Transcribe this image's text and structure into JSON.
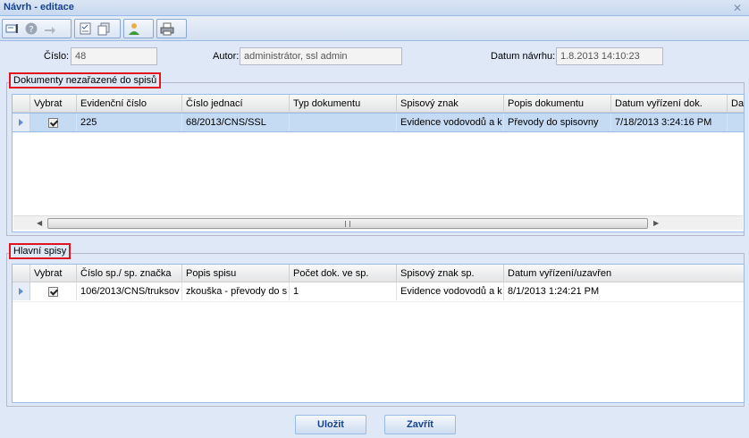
{
  "window": {
    "title": "Návrh - editace"
  },
  "form": {
    "cislo_label": "Číslo:",
    "cislo_value": "48",
    "autor_label": "Autor:",
    "autor_value": "administrátor, ssl admin",
    "datum_label": "Datum návrhu:",
    "datum_value": "1.8.2013 14:10:23"
  },
  "panel1": {
    "title": "Dokumenty nezařazené do spisů",
    "headers": [
      "Vybrat",
      "Evidenční číslo",
      "Číslo jednací",
      "Typ dokumentu",
      "Spisový znak",
      "Popis dokumentu",
      "Datum vyřízení dok.",
      "Da"
    ],
    "row": [
      "225",
      "68/2013/CNS/SSL",
      "",
      "Evidence vodovodů a k",
      "Převody do spisovny",
      "7/18/2013 3:24:16 PM",
      ""
    ]
  },
  "panel2": {
    "title": "Hlavní spisy",
    "headers": [
      "Vybrat",
      "Číslo sp./ sp. značka",
      "Popis spisu",
      "Počet dok. ve sp.",
      "Spisový znak sp.",
      "Datum vyřízení/uzavřen"
    ],
    "row": [
      "106/2013/CNS/truksov",
      "zkouška - převody do s",
      "1",
      "Evidence vodovodů a k",
      "8/1/2013 1:24:21 PM"
    ]
  },
  "buttons": {
    "save": "Uložit",
    "close": "Zavřít"
  }
}
